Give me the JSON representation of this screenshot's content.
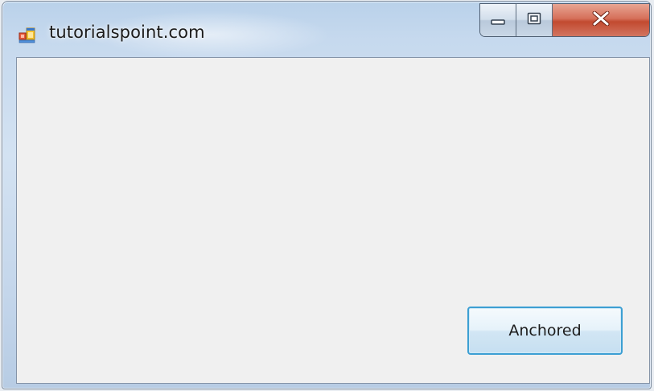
{
  "window": {
    "title": "tutorialspoint.com",
    "icon": "windows-form-app-icon",
    "caption_buttons": {
      "minimize_icon": "minimize-icon",
      "maximize_icon": "maximize-icon",
      "close_icon": "close-icon"
    }
  },
  "form": {
    "button_label": "Anchored"
  },
  "colors": {
    "client_background": "#f0f0f0",
    "button_focus_border": "#3c9fd3",
    "close_button": "#c24a30"
  }
}
